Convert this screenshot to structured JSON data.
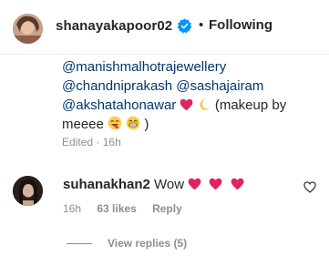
{
  "post_header": {
    "username": "shanayakapoor02",
    "separator": "•",
    "follow_label": "Following",
    "verified": true,
    "verified_color": "#0095f6"
  },
  "caption": {
    "lines": [
      {
        "text": "@manishmalhotrajewellery"
      },
      {
        "text": "@chandniprakash @sashajairam"
      },
      {
        "text": "@akshatahonawar"
      },
      {
        "text": "meeee"
      }
    ],
    "makeup_text": "(makeup by",
    "close_paren": ")",
    "edited_label": "Edited",
    "meta_separator": "·",
    "time": "16h"
  },
  "comment": {
    "username": "suhanakhan2",
    "text": "Wow",
    "time": "16h",
    "likes": "63 likes",
    "reply_label": "Reply",
    "heart_color": "#ed4956"
  },
  "replies": {
    "label": "View replies (5)"
  },
  "colors": {
    "mention": "#00376b",
    "text": "#262626",
    "secondary": "#8e8e8e"
  },
  "icons": [
    "verified-badge-icon",
    "heart-outline-icon",
    "red-heart-emoji",
    "crescent-moon-emoji",
    "smiling-face-emoji"
  ]
}
